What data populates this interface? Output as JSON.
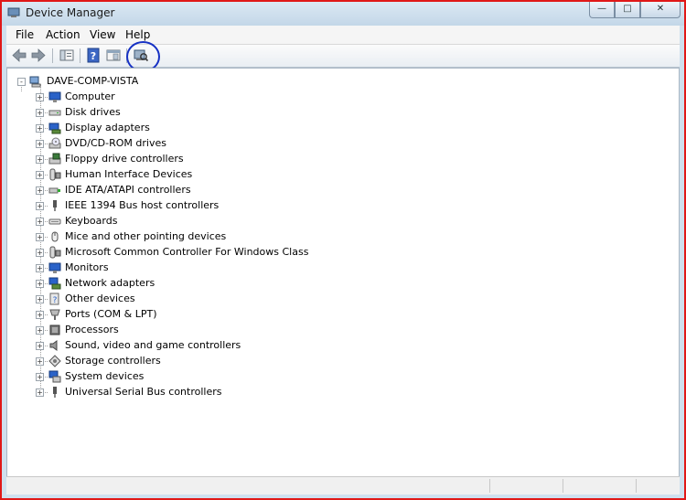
{
  "window": {
    "title": "Device Manager",
    "icons": {
      "app": "device-manager-icon",
      "minimize": "minimize-icon",
      "maximize": "maximize-icon",
      "close": "close-icon"
    },
    "controls": {
      "minimize": "—",
      "maximize": "□",
      "close": "✕"
    }
  },
  "menu": [
    {
      "label": "File"
    },
    {
      "label": "Action"
    },
    {
      "label": "View"
    },
    {
      "label": "Help"
    }
  ],
  "toolbar": {
    "icons": [
      "back-arrow-icon",
      "forward-arrow-icon",
      "properties-icon",
      "help-icon",
      "console-tree-icon",
      "scan-hardware-icon"
    ]
  },
  "annotation": {
    "color": "#1631c4",
    "shape": "circle",
    "target": "scan-hardware-icon"
  },
  "tree": {
    "root": {
      "label": "DAVE-COMP-VISTA",
      "icon": "computer-icon",
      "expander": "-"
    },
    "items": [
      {
        "label": "Computer",
        "icon": "monitor-icon",
        "expander": "+"
      },
      {
        "label": "Disk drives",
        "icon": "disk-drive-icon",
        "expander": "+"
      },
      {
        "label": "Display adapters",
        "icon": "display-adapter-icon",
        "expander": "+"
      },
      {
        "label": "DVD/CD-ROM drives",
        "icon": "dvd-icon",
        "expander": "+"
      },
      {
        "label": "Floppy drive controllers",
        "icon": "floppy-controller-icon",
        "expander": "+"
      },
      {
        "label": "Human Interface Devices",
        "icon": "hid-icon",
        "expander": "+"
      },
      {
        "label": "IDE ATA/ATAPI controllers",
        "icon": "ide-controller-icon",
        "expander": "+"
      },
      {
        "label": "IEEE 1394 Bus host controllers",
        "icon": "ieee1394-icon",
        "expander": "+"
      },
      {
        "label": "Keyboards",
        "icon": "keyboard-icon",
        "expander": "+"
      },
      {
        "label": "Mice and other pointing devices",
        "icon": "mouse-icon",
        "expander": "+"
      },
      {
        "label": "Microsoft Common Controller For Windows Class",
        "icon": "controller-icon",
        "expander": "+"
      },
      {
        "label": "Monitors",
        "icon": "monitor-icon",
        "expander": "+"
      },
      {
        "label": "Network adapters",
        "icon": "network-adapter-icon",
        "expander": "+"
      },
      {
        "label": "Other devices",
        "icon": "unknown-device-icon",
        "expander": "+"
      },
      {
        "label": "Ports (COM & LPT)",
        "icon": "port-icon",
        "expander": "+"
      },
      {
        "label": "Processors",
        "icon": "processor-icon",
        "expander": "+"
      },
      {
        "label": "Sound, video and game controllers",
        "icon": "speaker-icon",
        "expander": "+"
      },
      {
        "label": "Storage controllers",
        "icon": "storage-controller-icon",
        "expander": "+"
      },
      {
        "label": "System devices",
        "icon": "system-devices-icon",
        "expander": "+"
      },
      {
        "label": "Universal Serial Bus controllers",
        "icon": "usb-icon",
        "expander": "+"
      }
    ]
  },
  "colors": {
    "border": "#e01818",
    "chrome": "#cfe0ee",
    "icon_blue": "#2a62c8",
    "icon_gray": "#8a8f96"
  }
}
